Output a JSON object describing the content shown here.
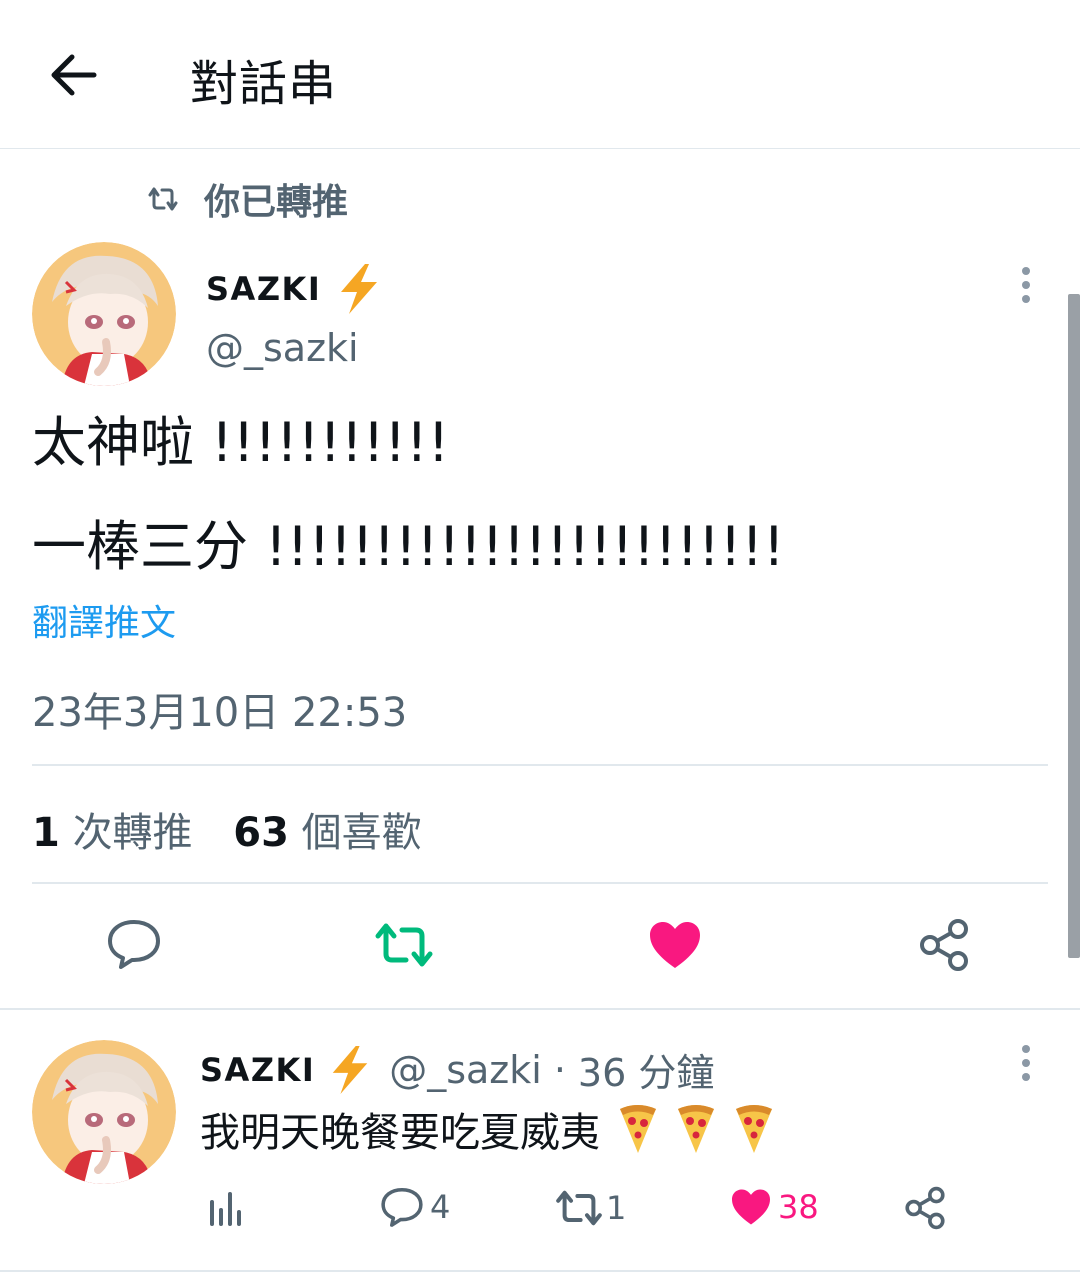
{
  "header": {
    "title": "對話串"
  },
  "social_context": {
    "label": "你已轉推"
  },
  "tweet": {
    "author_name": "SAZKI",
    "author_handle": "@_sazki",
    "text_line1": "太神啦 !!!!!!!!!!!",
    "text_line2": "一棒三分 !!!!!!!!!!!!!!!!!!!!!!!!",
    "translate_label": "翻譯推文",
    "timestamp": "23年3月10日 22:53",
    "retweet_count": "1",
    "retweet_label": "次轉推",
    "like_count": "63",
    "like_label": "個喜歡"
  },
  "reply": {
    "author_name": "SAZKI",
    "author_handle": "@_sazki",
    "separator": "·",
    "time_ago": "36 分鐘",
    "text": "我明天晚餐要吃夏威夷",
    "reply_count": "4",
    "retweet_count": "1",
    "like_count": "38"
  },
  "icons": {
    "verified_badge": "lightning-bolt",
    "retweet_active_color": "#00ba7c",
    "like_active_color": "#f91880",
    "link_color": "#1d9bf0",
    "muted_color": "#536471"
  }
}
